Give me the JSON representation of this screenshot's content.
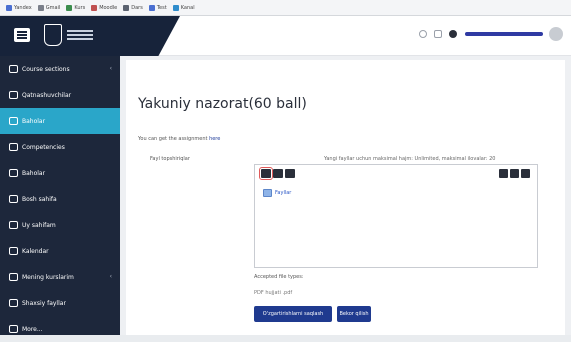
{
  "header": {
    "logo_alt": "university-logo"
  },
  "sidebar": {
    "items": [
      {
        "label": "Course sections",
        "icon": "folder-icon",
        "active": false,
        "chevron": "‹"
      },
      {
        "label": "Qatnashuvchilar",
        "icon": "users-icon",
        "active": false
      },
      {
        "label": "Baholar",
        "icon": "grades-icon",
        "active": true
      },
      {
        "label": "Competencies",
        "icon": "competency-icon",
        "active": false
      },
      {
        "label": "Baholar",
        "icon": "table-icon",
        "active": false
      },
      {
        "label": "Bosh sahifa",
        "icon": "home-icon",
        "active": false
      },
      {
        "label": "Uy sahifam",
        "icon": "dashboard-icon",
        "active": false
      },
      {
        "label": "Kalendar",
        "icon": "calendar-icon",
        "active": false
      },
      {
        "label": "Mening kurslarim",
        "icon": "graduation-icon",
        "active": false,
        "chevron": "‹"
      },
      {
        "label": "Shaxsiy fayllar",
        "icon": "file-icon",
        "active": false
      },
      {
        "label": "More...",
        "icon": "more-icon",
        "active": false
      }
    ]
  },
  "main": {
    "title": "Yakuniy nazorat(60 ball)",
    "intro_text": "You can get the assignment",
    "intro_link": "here",
    "field_label": "Fayl topshiriqlar",
    "hint": "Yangi fayllar uchun maksimal hajm: Unlimited, maksimal ilovalar: 20",
    "folder_label": "Fayllar",
    "accepted_label": "Accepted file types:",
    "file_types": "PDF hujjati .pdf",
    "save_button": "O'zgartirishlarni saqlash",
    "cancel_button": "Bekor qilish"
  },
  "colors": {
    "sidebar_bg": "#1d273b",
    "active_item": "#2aa6c9",
    "primary_button": "#1f3a8f",
    "link": "#1f3c99"
  }
}
